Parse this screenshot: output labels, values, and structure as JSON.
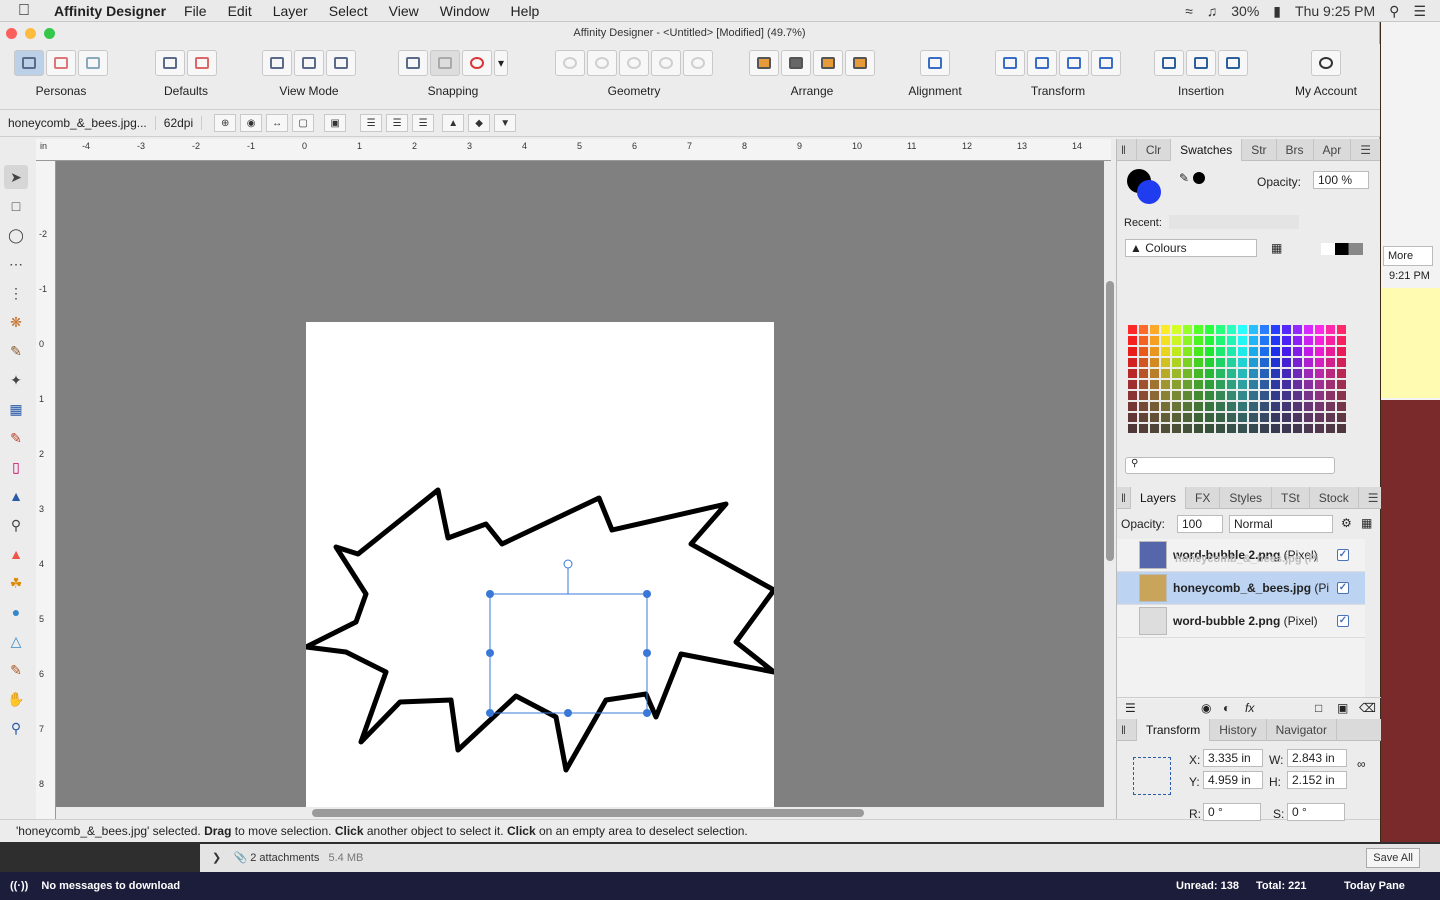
{
  "menubar": {
    "app_name": "Affinity Designer",
    "menus": [
      "File",
      "Edit",
      "Layer",
      "Select",
      "View",
      "Window",
      "Help"
    ],
    "battery": "30%",
    "clock": "Thu 9:25 PM"
  },
  "window": {
    "title": "Affinity Designer - <Untitled> [Modified] (49.7%)"
  },
  "toolbar": {
    "groups": [
      "Personas",
      "Defaults",
      "View Mode",
      "Snapping",
      "Geometry",
      "Arrange",
      "Alignment",
      "Transform",
      "Insertion",
      "My Account"
    ]
  },
  "context": {
    "filename": "honeycomb_&_bees.jpg...",
    "dpi": "62dpi"
  },
  "ruler": {
    "unit": "in",
    "h_ticks": [
      "-4",
      "-3",
      "-2",
      "-1",
      "0",
      "1",
      "2",
      "3",
      "4",
      "5",
      "6",
      "7",
      "8",
      "9",
      "10",
      "11",
      "12",
      "13",
      "14"
    ],
    "v_ticks": [
      "-2",
      "-1",
      "0",
      "1",
      "2",
      "3",
      "4",
      "5",
      "6",
      "7",
      "8"
    ]
  },
  "status": {
    "selected": "'honeycomb_&_bees.jpg' selected.",
    "drag": "Drag",
    "drag_text": "to move selection.",
    "click": "Click",
    "click_text": "another object to select it.",
    "click2": "Click",
    "click2_text": "on an empty area to deselect selection."
  },
  "color_panel": {
    "tabs": [
      "Clr",
      "Swatches",
      "Str",
      "Brs",
      "Apr"
    ],
    "active_tab": "Swatches",
    "opacity_label": "Opacity:",
    "opacity_value": "100 %",
    "recent_label": "Recent:",
    "palette_name": "Colours",
    "search_placeholder": ""
  },
  "layers_panel": {
    "tabs": [
      "Layers",
      "FX",
      "Styles",
      "TSt",
      "Stock"
    ],
    "active_tab": "Layers",
    "opacity_label": "Opacity:",
    "opacity_value": "100",
    "blend_mode": "Normal",
    "layers": [
      {
        "name": "word-bubble 2.png",
        "kind": "(Pixel)",
        "selected": false
      },
      {
        "name": "honeycomb_&_bees.jpg",
        "kind": "(Pi",
        "selected": true
      },
      {
        "name": "word-bubble 2.png",
        "kind": "(Pixel)",
        "selected": false
      }
    ],
    "ghost_text": "honeycomb_&_bees.jpg (Pi"
  },
  "transform_panel": {
    "tabs": [
      "Transform",
      "History",
      "Navigator"
    ],
    "active_tab": "Transform",
    "x_label": "X:",
    "x": "3.335 in",
    "y_label": "Y:",
    "y": "4.959 in",
    "w_label": "W:",
    "w": "2.843 in",
    "h_label": "H:",
    "h": "2.152 in",
    "r_label": "R:",
    "r": "0 °",
    "s_label": "S:",
    "s": "0 °"
  },
  "mail": {
    "attachments": "2 attachments",
    "size": "5.4 MB",
    "save_all": "Save All",
    "messages": "No messages to download",
    "unread": "Unread: 138",
    "total": "Total: 221",
    "today_pane": "Today Pane"
  },
  "side_window": {
    "more": "More",
    "time": "9:21 PM"
  },
  "colors": {
    "canvas_bg": "#808080",
    "selection": "#3a78d8",
    "fill_primary": "#000000",
    "fill_secondary": "#1f3cf0"
  }
}
